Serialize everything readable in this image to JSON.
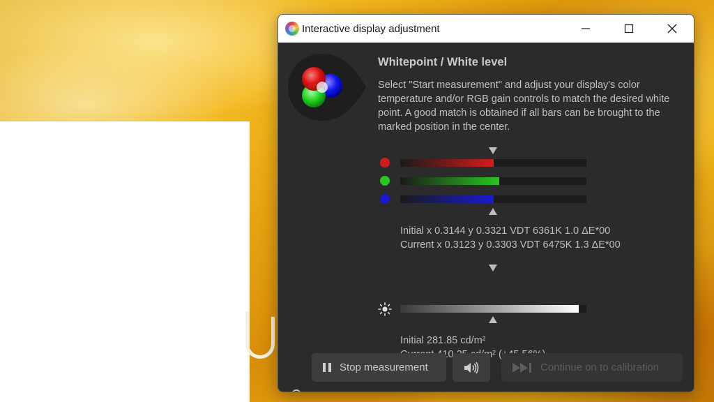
{
  "window": {
    "title": "Interactive display adjustment"
  },
  "panel": {
    "heading": "Whitepoint / White level",
    "description": "Select \"Start measurement\" and adjust your display's color temperature and/or RGB gain controls to match the desired white point. A good match is obtained if all bars can be brought to the marked position in the center."
  },
  "rgb_bars": [
    {
      "channel": "red",
      "color": "#d21b1b",
      "level": 0.5
    },
    {
      "channel": "green",
      "color": "#29c71f",
      "level": 0.53
    },
    {
      "channel": "blue",
      "color": "#1a1ad0",
      "level": 0.5
    }
  ],
  "whitepoint": {
    "initial": "Initial x 0.3144 y 0.3321 VDT 6361K 1.0 ΔE*00",
    "current": "Current x 0.3123 y 0.3303 VDT 6475K 1.3 ΔE*00"
  },
  "luminance": {
    "level": 0.96,
    "initial": "Initial 281.85 cd/m²",
    "current": "Current 410.25 cd/m² (+45.56%)"
  },
  "buttons": {
    "stop_label": "Stop measurement",
    "continue_label": "Continue on to calibration"
  },
  "icons": {
    "app": "displaycal-icon",
    "pause": "pause-icon",
    "sound": "speaker-icon",
    "continue": "fast-forward-icon",
    "brightness": "sun-icon"
  }
}
